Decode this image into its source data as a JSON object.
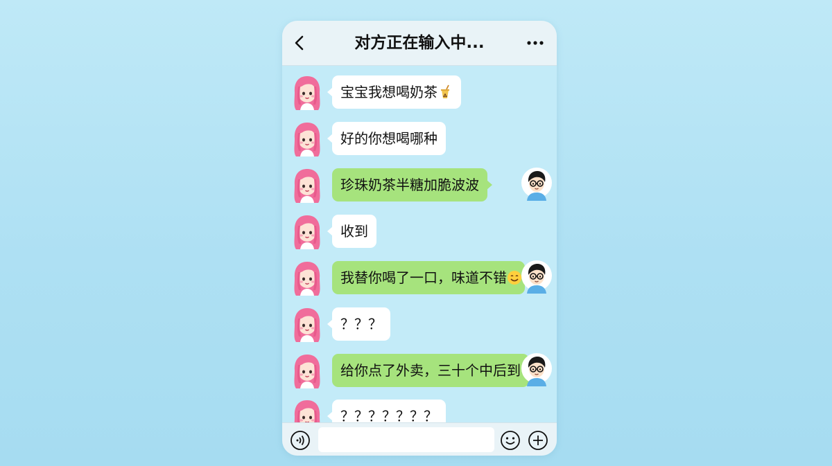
{
  "header": {
    "title": "对方正在输入中...",
    "back_icon": "chevron-left-icon",
    "more_icon": "more-dots-icon"
  },
  "messages": [
    {
      "sender": "girl",
      "text": "宝宝我想喝奶茶",
      "emoji": "bubble-tea-emoji"
    },
    {
      "sender": "girl",
      "text": "好的你想喝哪种"
    },
    {
      "sender": "boy",
      "text": "珍珠奶茶半糖加脆波波"
    },
    {
      "sender": "girl",
      "text": "收到"
    },
    {
      "sender": "boy",
      "text": "我替你喝了一口，味道不错",
      "emoji": "smile-emoji"
    },
    {
      "sender": "girl",
      "text": "？？？"
    },
    {
      "sender": "boy",
      "text": "给你点了外卖，三十个中后到"
    },
    {
      "sender": "girl",
      "text": "？？？？？？？"
    }
  ],
  "input_bar": {
    "voice_icon": "voice-icon",
    "text_value": "",
    "emoji_icon": "emoji-icon",
    "plus_icon": "plus-icon"
  },
  "colors": {
    "background": "#b5e4f5",
    "chat_background": "#c3ebf8",
    "header_background": "#e9f3f7",
    "received_bubble": "#ffffff",
    "sent_bubble": "#a6e37d",
    "girl_hair": "#f06d9b",
    "boy_shirt": "#5aaee6"
  }
}
